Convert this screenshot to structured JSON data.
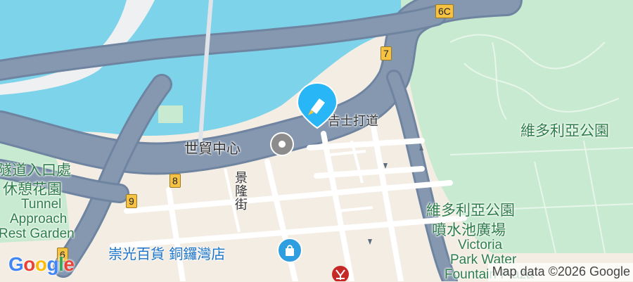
{
  "map": {
    "colors": {
      "water": "#7dd3ea",
      "land": "#f3ede3",
      "park": "#c7ead0",
      "road": "#8598b0",
      "roadEdge": "#6e84a0",
      "street": "#ffffff",
      "marker_active": "#29b6f6",
      "marker_shopping": "#2f9ee0",
      "mtr": "#c62828"
    },
    "labels": {
      "gloucester_road": "告士打道",
      "world_trade_centre": "世貿中心",
      "king_lung_street": "景隆街",
      "tunnel_rest_garden_zh_1": "隧道入口處",
      "tunnel_rest_garden_zh_2": "休憩花園",
      "tunnel_rest_garden_en_1": "Tunnel",
      "tunnel_rest_garden_en_2": "Approach",
      "tunnel_rest_garden_en_3": "Rest Garden",
      "victoria_park": "維多利亞公園",
      "fountain_plaza_zh_1": "維多利亞公園",
      "fountain_plaza_zh_2": "噴水池廣場",
      "fountain_plaza_en_1": "Victoria",
      "fountain_plaza_en_2": "Park Water",
      "fountain_plaza_en_3": "Fountain Plaza",
      "sogo": "崇光百貨 銅鑼灣店"
    },
    "route_shields": {
      "r6c": "6C",
      "r7": "7",
      "r8": "8",
      "r9": "9",
      "r6": "6"
    },
    "markers": {
      "selected": "pin-icon",
      "world_trade_centre": "circle-icon",
      "sogo": "shopping-bag-icon",
      "mtr": "mtr-icon"
    }
  },
  "branding": {
    "logo": "Google",
    "attribution": "Map data ©2026 Google"
  }
}
